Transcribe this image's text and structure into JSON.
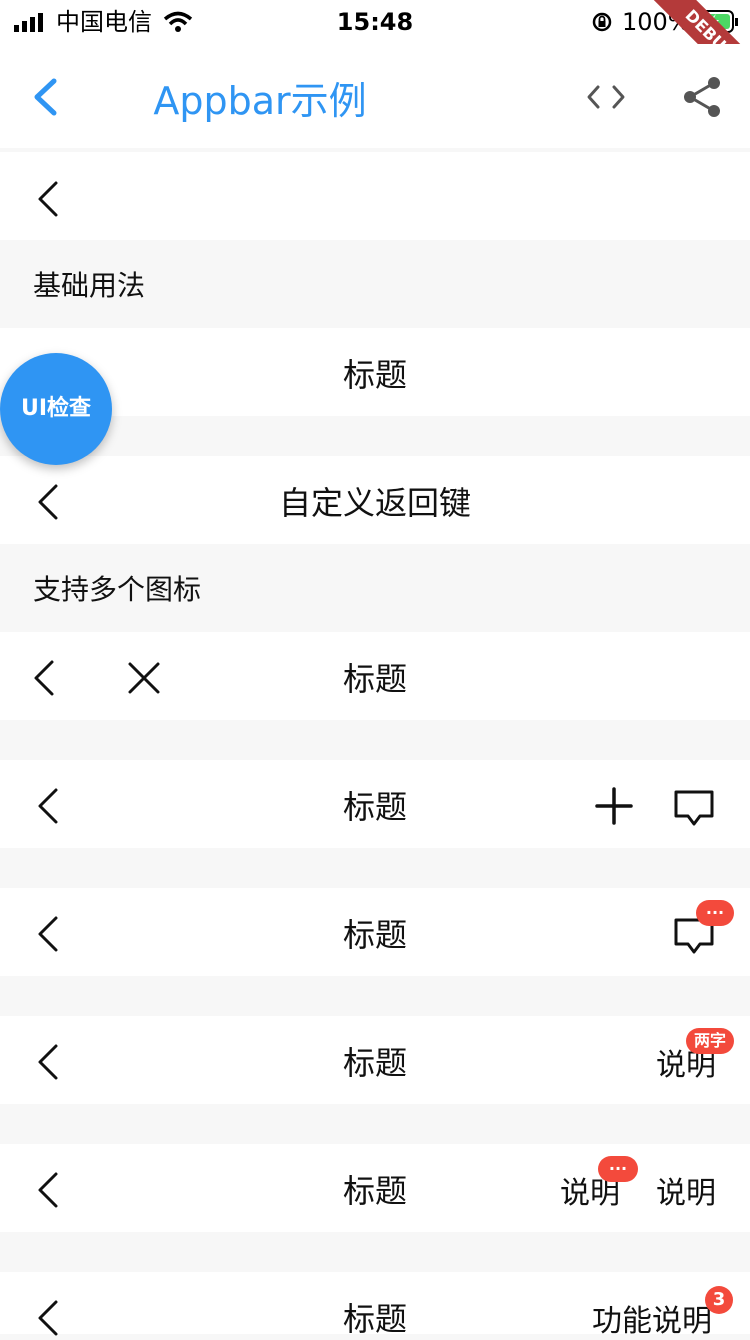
{
  "status_bar": {
    "carrier": "中国电信",
    "time": "15:48",
    "battery": "100%"
  },
  "debug_label": "DEBUG",
  "navbar": {
    "title": "Appbar示例"
  },
  "sections": {
    "basic": "基础用法",
    "multi_icons": "支持多个图标"
  },
  "rows": {
    "row1_title": "标题",
    "row2_title": "自定义返回键",
    "row3_title": "标题",
    "row4_title": "标题",
    "row5_title": "标题",
    "row6_title": "标题",
    "row7_title": "标题",
    "row8_title": "标题"
  },
  "badges": {
    "dots": "···",
    "two_chars": "两字",
    "count": "3"
  },
  "actions": {
    "desc": "说明",
    "func_desc": "功能说明"
  },
  "fab_label": "UI检查",
  "colors": {
    "accent": "#2f95f3",
    "badge": "#f34a3c",
    "section_bg": "#f7f7f7"
  }
}
